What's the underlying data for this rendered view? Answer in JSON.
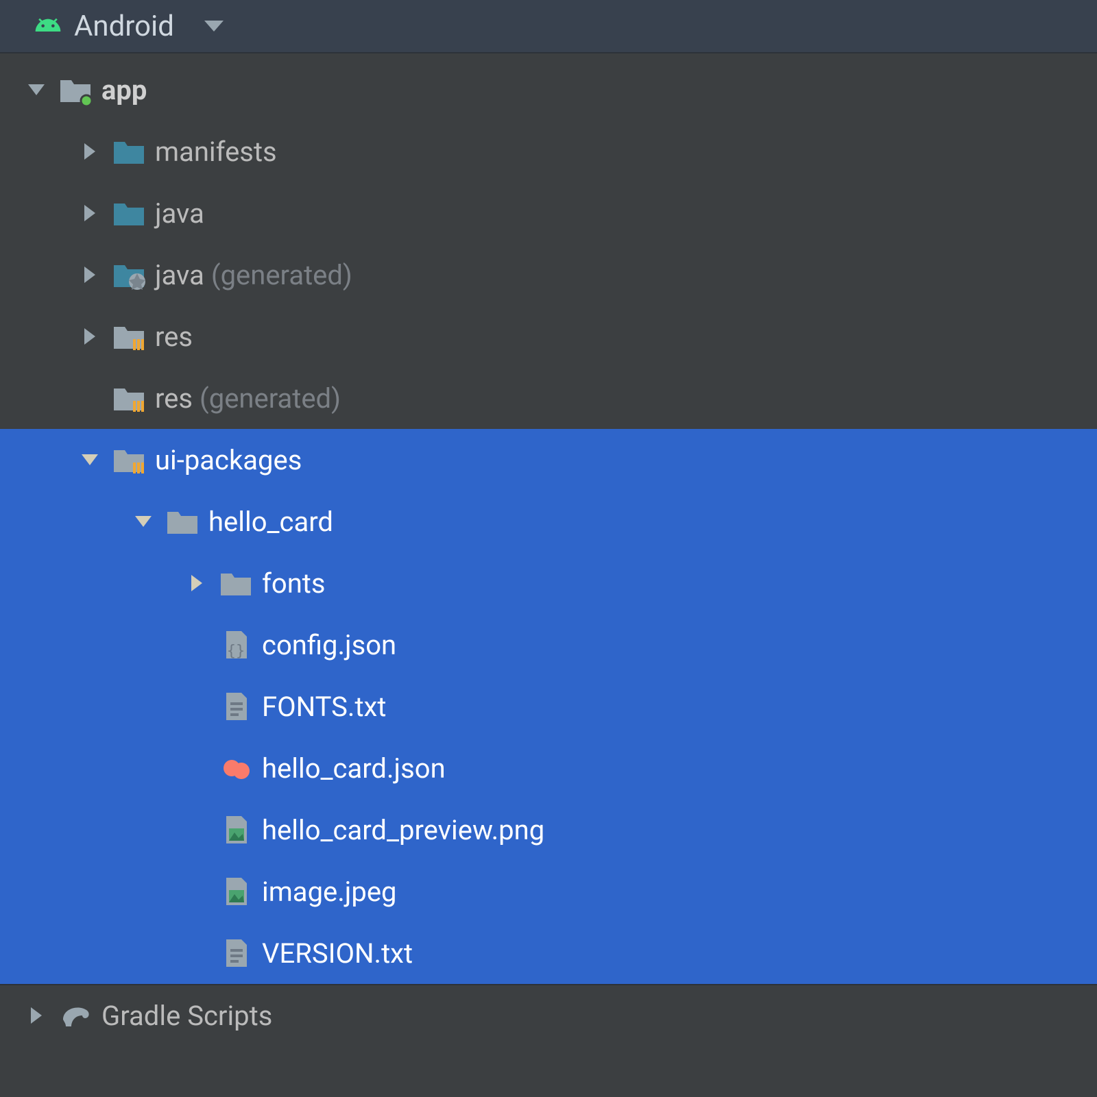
{
  "header": {
    "view_label": "Android"
  },
  "tree": {
    "app": {
      "label": "app",
      "children": {
        "manifests": {
          "label": "manifests"
        },
        "java": {
          "label": "java"
        },
        "java_gen": {
          "label": "java",
          "suffix": "(generated)"
        },
        "res": {
          "label": "res"
        },
        "res_gen": {
          "label": "res",
          "suffix": "(generated)"
        },
        "ui_packages": {
          "label": "ui-packages",
          "hello_card": {
            "label": "hello_card",
            "fonts": {
              "label": "fonts"
            },
            "files": {
              "config": "config.json",
              "fonts_txt": "FONTS.txt",
              "hello_card_json": "hello_card.json",
              "preview_png": "hello_card_preview.png",
              "image_jpeg": "image.jpeg",
              "version_txt": "VERSION.txt"
            }
          }
        }
      }
    },
    "gradle": {
      "label": "Gradle Scripts"
    }
  }
}
